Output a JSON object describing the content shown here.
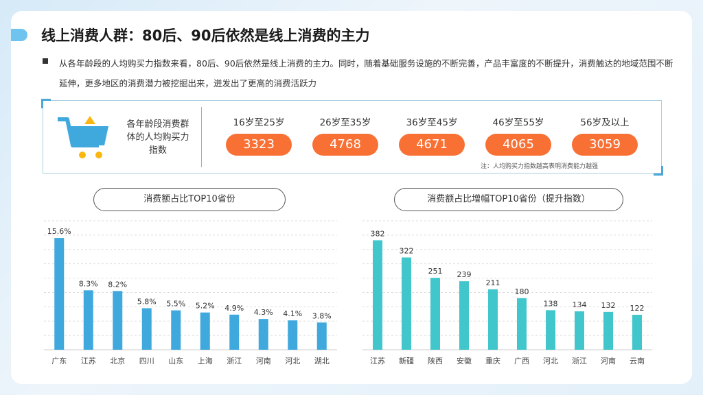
{
  "title": "线上消费人群：80后、90后依然是线上消费的主力",
  "description": "从各年龄段的人均购买力指数来看，80后、90后依然是线上消费的主力。同时，随着基础服务设施的不断完善，产品丰富度的不断提升，消费触达的地域范围不断延伸，更多地区的消费潜力被挖掘出来，迸发出了更高的消费活跃力",
  "panel": {
    "label": "各年龄段消费群体的人均购买力指数",
    "icon": "shopping-cart-icon",
    "ages": [
      {
        "label": "16岁至25岁",
        "value": "3323"
      },
      {
        "label": "26岁至35岁",
        "value": "4768"
      },
      {
        "label": "36岁至45岁",
        "value": "4671"
      },
      {
        "label": "46岁至55岁",
        "value": "4065"
      },
      {
        "label": "56岁及以上",
        "value": "3059"
      }
    ],
    "note": "注：人均购买力指数越高表明消费能力越强",
    "accent": "#f97034"
  },
  "chart_data": [
    {
      "type": "bar",
      "title": "消费额占比TOP10省份",
      "categories": [
        "广东",
        "江苏",
        "北京",
        "四川",
        "山东",
        "上海",
        "浙江",
        "河南",
        "河北",
        "湖北"
      ],
      "values": [
        15.6,
        8.3,
        8.2,
        5.8,
        5.5,
        5.2,
        4.9,
        4.3,
        4.1,
        3.8
      ],
      "labels": [
        "15.6%",
        "8.3%",
        "8.2%",
        "5.8%",
        "5.5%",
        "5.2%",
        "4.9%",
        "4.3%",
        "4.1%",
        "3.8%"
      ],
      "ylim": [
        0,
        18
      ],
      "grid": true,
      "color": "#3fa9de"
    },
    {
      "type": "bar",
      "title": "消费额占比增幅TOP10省份（提升指数）",
      "categories": [
        "江苏",
        "新疆",
        "陕西",
        "安徽",
        "重庆",
        "广西",
        "河北",
        "浙江",
        "河南",
        "云南"
      ],
      "values": [
        382,
        322,
        251,
        239,
        211,
        180,
        138,
        134,
        132,
        122
      ],
      "labels": [
        "382",
        "322",
        "251",
        "239",
        "211",
        "180",
        "138",
        "134",
        "132",
        "122"
      ],
      "ylim": [
        0,
        450
      ],
      "grid": true,
      "color": "#40c6cb"
    }
  ]
}
